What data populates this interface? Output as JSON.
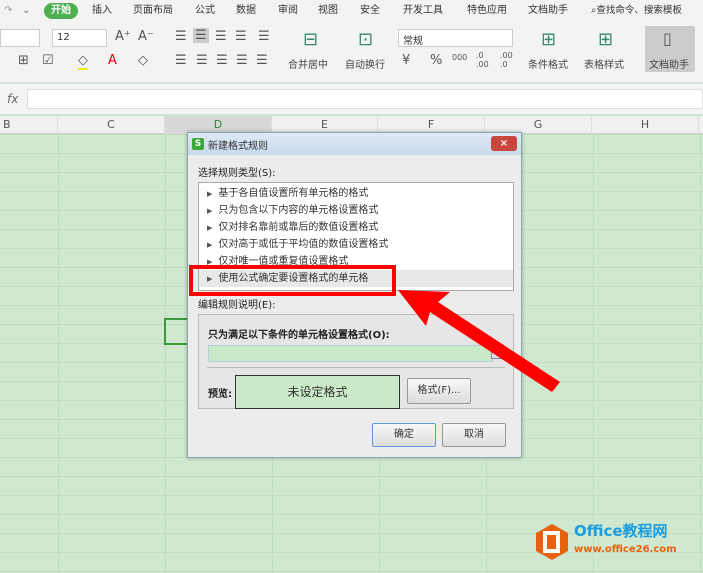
{
  "menu": {
    "tabs": [
      "开始",
      "插入",
      "页面布局",
      "公式",
      "数据",
      "审阅",
      "视图",
      "安全",
      "开发工具",
      "特色应用",
      "文档助手"
    ],
    "search": "查找命令、搜索模板"
  },
  "ribbon": {
    "font_size": "12",
    "number_format": "常规",
    "merge": "合并居中",
    "wrap": "自动换行",
    "cond_format": "条件格式",
    "table_style": "表格样式",
    "doc_helper": "文档助手"
  },
  "formula": {
    "fx": "fx",
    "value": ""
  },
  "columns": [
    "B",
    "C",
    "D",
    "E",
    "F",
    "G",
    "H"
  ],
  "dialog": {
    "title": "新建格式规则",
    "close": "×",
    "rule_type_label": "选择规则类型(S):",
    "rules": [
      "基于各自值设置所有单元格的格式",
      "只为包含以下内容的单元格设置格式",
      "仅对排名靠前或靠后的数值设置格式",
      "仅对高于或低于平均值的数值设置格式",
      "仅对唯一值或重复值设置格式",
      "使用公式确定要设置格式的单元格"
    ],
    "edit_label": "编辑规则说明(E):",
    "condition_label": "只为满足以下条件的单元格设置格式(O):",
    "condition_value": "",
    "preview_label": "预览:",
    "preview_text": "未设定格式",
    "format_button": "格式(F)...",
    "ok": "确定",
    "cancel": "取消"
  },
  "watermark": {
    "brand": "Office教程网",
    "url": "www.office26.com"
  },
  "colors": {
    "accent": "#4caf50",
    "highlight": "#ff0000"
  }
}
